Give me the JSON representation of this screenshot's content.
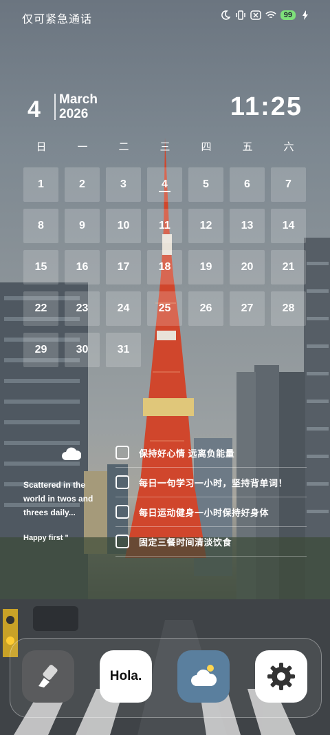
{
  "status_bar": {
    "carrier_text": "仅可紧急通话",
    "battery_level": "99",
    "icons": [
      "moon-icon",
      "vibrate-icon",
      "sim-off-icon",
      "wifi-icon",
      "battery-icon",
      "charging-icon"
    ]
  },
  "date": {
    "day": "4",
    "month": "March",
    "year": "2026"
  },
  "clock": {
    "time": "11:25"
  },
  "calendar": {
    "weekdays": [
      "日",
      "一",
      "二",
      "三",
      "四",
      "五",
      "六"
    ],
    "days": [
      "1",
      "2",
      "3",
      "4",
      "5",
      "6",
      "7",
      "8",
      "9",
      "10",
      "11",
      "12",
      "13",
      "14",
      "15",
      "16",
      "17",
      "18",
      "19",
      "20",
      "21",
      "22",
      "23",
      "24",
      "25",
      "26",
      "27",
      "28",
      "29",
      "30",
      "31"
    ],
    "today": "4"
  },
  "weather": {
    "icon": "cloud-icon",
    "note": "Scattered in the world in twos and threes daily...",
    "footer": "Happy first \""
  },
  "todos": [
    {
      "text": "保持好心情 远离负能量"
    },
    {
      "text": "每日一句学习一小时，坚持背单词！"
    },
    {
      "text": "每日运动健身一小时保持好身体"
    },
    {
      "text": "固定三餐时间清淡饮食"
    }
  ],
  "dock": {
    "apps": [
      {
        "icon": "brush-icon"
      },
      {
        "label": "Hola."
      },
      {
        "icon": "weather-icon"
      },
      {
        "icon": "settings-gear-icon"
      }
    ]
  }
}
